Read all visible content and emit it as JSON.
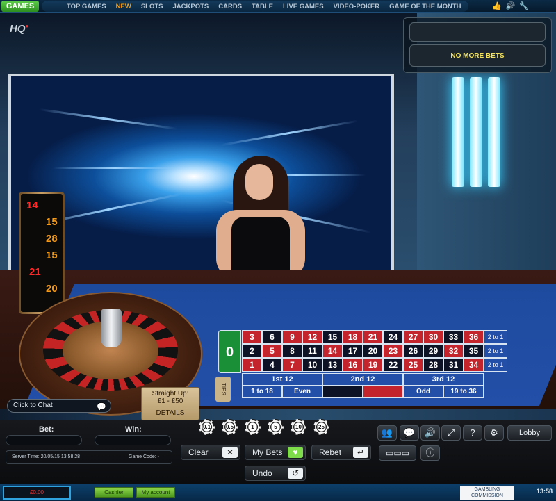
{
  "nav": {
    "games_label": "GAMES",
    "items": [
      "TOP GAMES",
      "NEW",
      "SLOTS",
      "JACKPOTS",
      "CARDS",
      "TABLE",
      "LIVE GAMES",
      "VIDEO-POKER",
      "GAME OF THE MONTH"
    ],
    "icons": [
      "thumbs-up-icon",
      "speaker-icon",
      "wrench-icon"
    ]
  },
  "stream": {
    "logo": "HQ",
    "status": "NO MORE BETS"
  },
  "history": {
    "numbers": [
      {
        "value": "14",
        "color": "red"
      },
      {
        "value": "15",
        "color": "orange"
      },
      {
        "value": "28",
        "color": "orange"
      },
      {
        "value": "15",
        "color": "orange"
      },
      {
        "value": "21",
        "color": "red"
      },
      {
        "value": "20",
        "color": "orange"
      }
    ]
  },
  "layout": {
    "zero": "0",
    "rows": [
      [
        {
          "n": "3",
          "c": "red"
        },
        {
          "n": "6",
          "c": "black"
        },
        {
          "n": "9",
          "c": "red"
        },
        {
          "n": "12",
          "c": "red"
        },
        {
          "n": "15",
          "c": "black"
        },
        {
          "n": "18",
          "c": "red"
        },
        {
          "n": "21",
          "c": "red"
        },
        {
          "n": "24",
          "c": "black"
        },
        {
          "n": "27",
          "c": "red"
        },
        {
          "n": "30",
          "c": "red"
        },
        {
          "n": "33",
          "c": "black"
        },
        {
          "n": "36",
          "c": "red"
        }
      ],
      [
        {
          "n": "2",
          "c": "black"
        },
        {
          "n": "5",
          "c": "red"
        },
        {
          "n": "8",
          "c": "black"
        },
        {
          "n": "11",
          "c": "black"
        },
        {
          "n": "14",
          "c": "red"
        },
        {
          "n": "17",
          "c": "black"
        },
        {
          "n": "20",
          "c": "black"
        },
        {
          "n": "23",
          "c": "red"
        },
        {
          "n": "26",
          "c": "black"
        },
        {
          "n": "29",
          "c": "black"
        },
        {
          "n": "32",
          "c": "red"
        },
        {
          "n": "35",
          "c": "black"
        }
      ],
      [
        {
          "n": "1",
          "c": "red"
        },
        {
          "n": "4",
          "c": "black"
        },
        {
          "n": "7",
          "c": "red"
        },
        {
          "n": "10",
          "c": "black"
        },
        {
          "n": "13",
          "c": "black"
        },
        {
          "n": "16",
          "c": "red"
        },
        {
          "n": "19",
          "c": "red"
        },
        {
          "n": "22",
          "c": "black"
        },
        {
          "n": "25",
          "c": "red"
        },
        {
          "n": "28",
          "c": "black"
        },
        {
          "n": "31",
          "c": "black"
        },
        {
          "n": "34",
          "c": "red"
        }
      ]
    ],
    "column_bet": "2 to 1",
    "dozens": [
      "1st 12",
      "2nd 12",
      "3rd 12"
    ],
    "outside": [
      {
        "label": "1 to 18",
        "c": "blue"
      },
      {
        "label": "Even",
        "c": "blue"
      },
      {
        "label": "",
        "c": "black"
      },
      {
        "label": "",
        "c": "red"
      },
      {
        "label": "Odd",
        "c": "blue"
      },
      {
        "label": "19 to 36",
        "c": "blue"
      }
    ],
    "tips": "TIPS"
  },
  "limits": {
    "title": "Straight Up:",
    "range": "£1 - £50",
    "details": "DETAILS"
  },
  "chat": {
    "label": "Click to Chat"
  },
  "panel": {
    "bet_label": "Bet:",
    "win_label": "Win:",
    "server_time": "Server Time: 20/05/15 13:58:28",
    "game_code": "Game Code: -",
    "chips": [
      "0.1",
      "0.5",
      "1",
      "5",
      "10",
      "25"
    ],
    "clear_label": "Clear",
    "my_bets_label": "My Bets",
    "rebet_label": "Rebet",
    "undo_label": "Undo",
    "lobby_label": "Lobby"
  },
  "footer": {
    "balance": "£0.00",
    "cashier_label": "Cashier",
    "account_label": "My account",
    "commission_line1": "GAMBLING",
    "commission_line2": "COMMISSION",
    "clock": "13:58"
  }
}
